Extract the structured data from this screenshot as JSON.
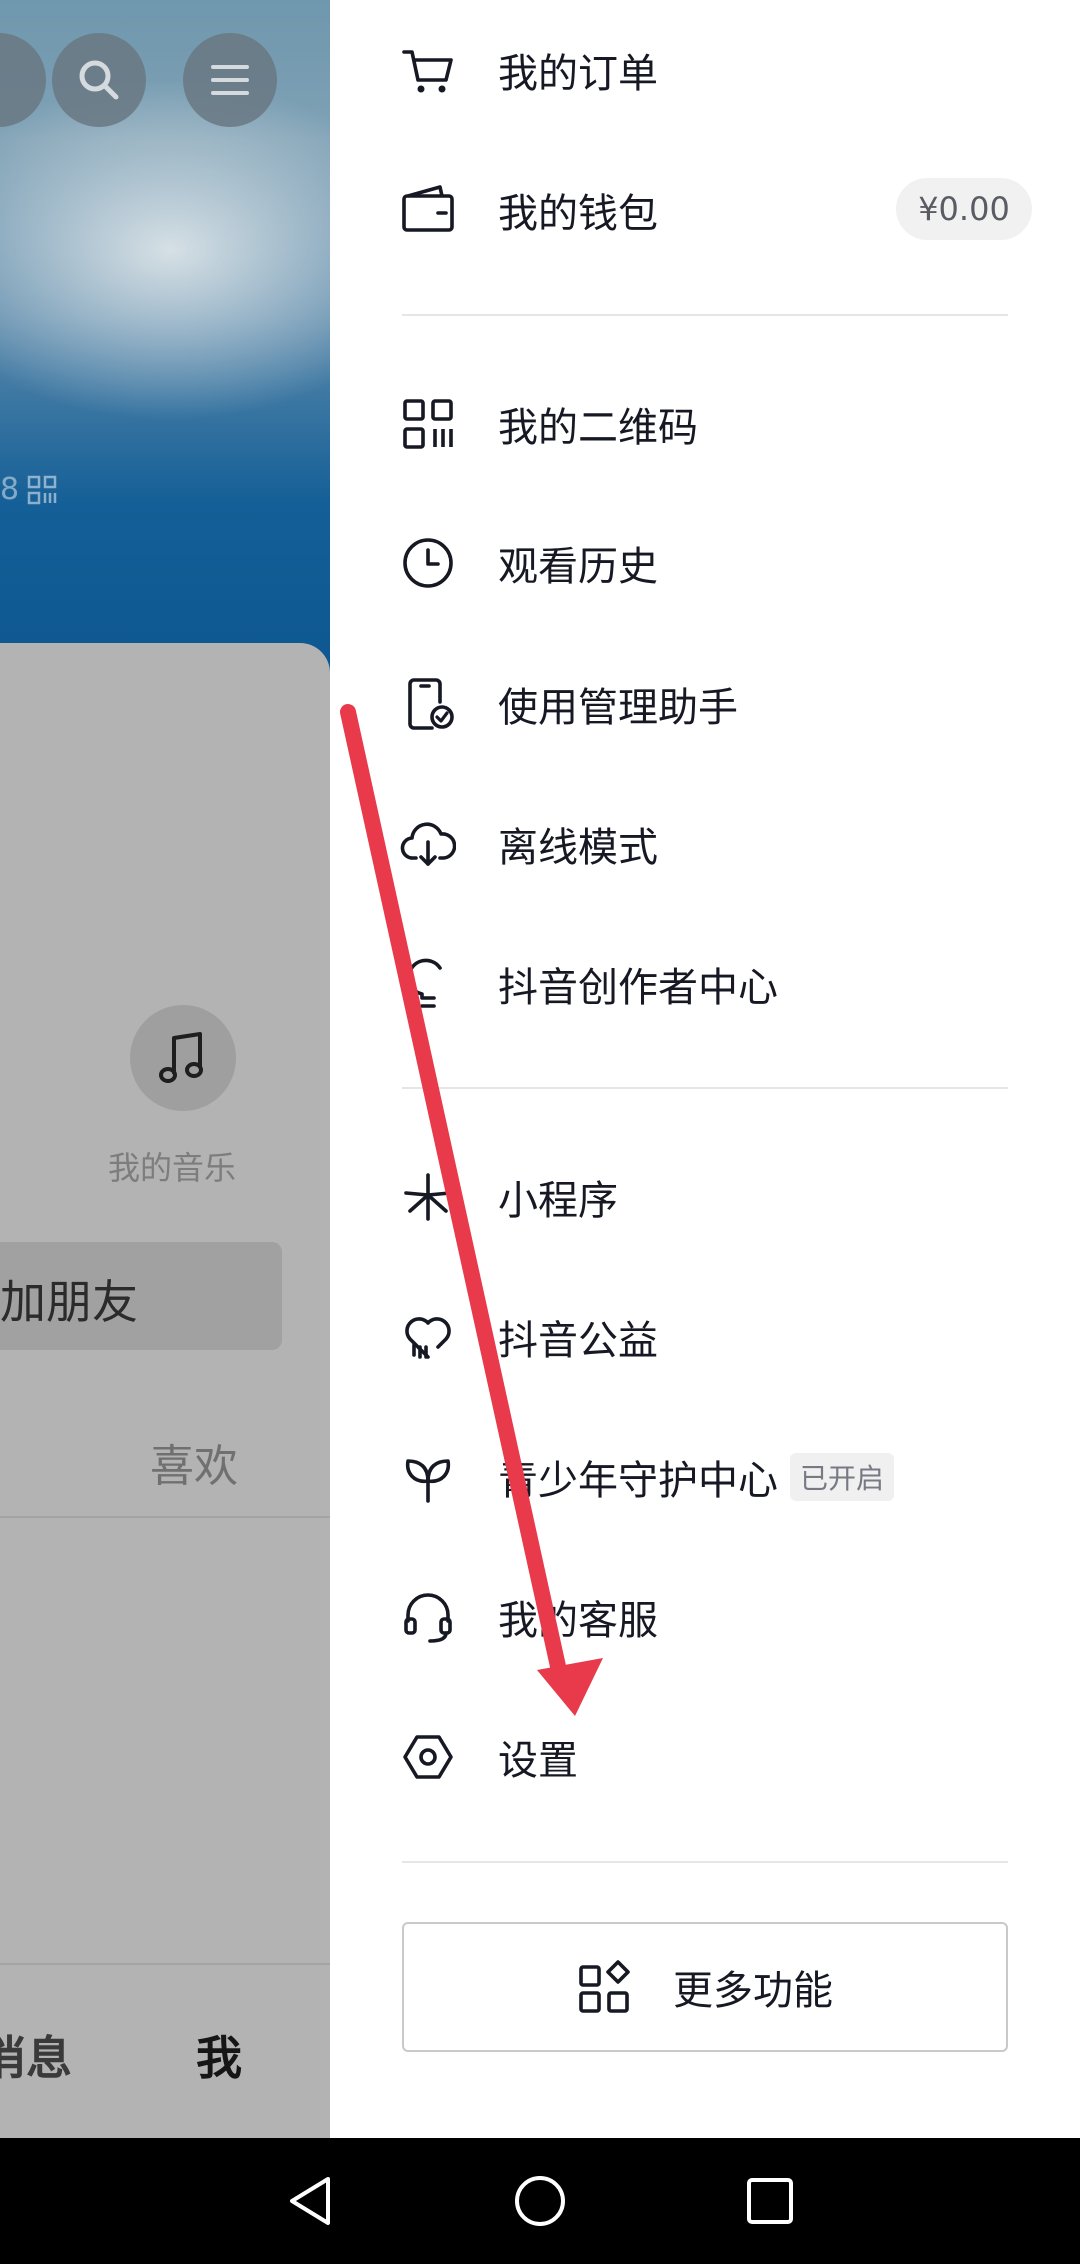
{
  "background_page": {
    "id_fragment": "8",
    "music_label": "我的音乐",
    "add_friend_label": "加朋友",
    "likes_tab": "喜欢",
    "nav_message": "消息",
    "nav_me": "我"
  },
  "drawer": {
    "group1": [
      {
        "icon": "cart-icon",
        "label": "我的订单"
      },
      {
        "icon": "wallet-icon",
        "label": "我的钱包",
        "badge": "¥0.00"
      }
    ],
    "group2": [
      {
        "icon": "qr-code-icon",
        "label": "我的二维码"
      },
      {
        "icon": "clock-icon",
        "label": "观看历史"
      },
      {
        "icon": "phone-check-icon",
        "label": "使用管理助手"
      },
      {
        "icon": "cloud-download-icon",
        "label": "离线模式"
      },
      {
        "icon": "lightbulb-icon",
        "label": "抖音创作者中心"
      }
    ],
    "group3": [
      {
        "icon": "mini-program-icon",
        "label": "小程序"
      },
      {
        "icon": "heart-charity-icon",
        "label": "抖音公益"
      },
      {
        "icon": "sprout-icon",
        "label": "青少年守护中心",
        "badge": "已开启"
      },
      {
        "icon": "headset-icon",
        "label": "我的客服"
      },
      {
        "icon": "settings-hexagon-icon",
        "label": "设置"
      }
    ],
    "more_button": "更多功能"
  },
  "annotation": {
    "arrow_color": "#e83a4a"
  },
  "colors": {
    "text": "#161823",
    "divider": "#e6e6e6"
  }
}
